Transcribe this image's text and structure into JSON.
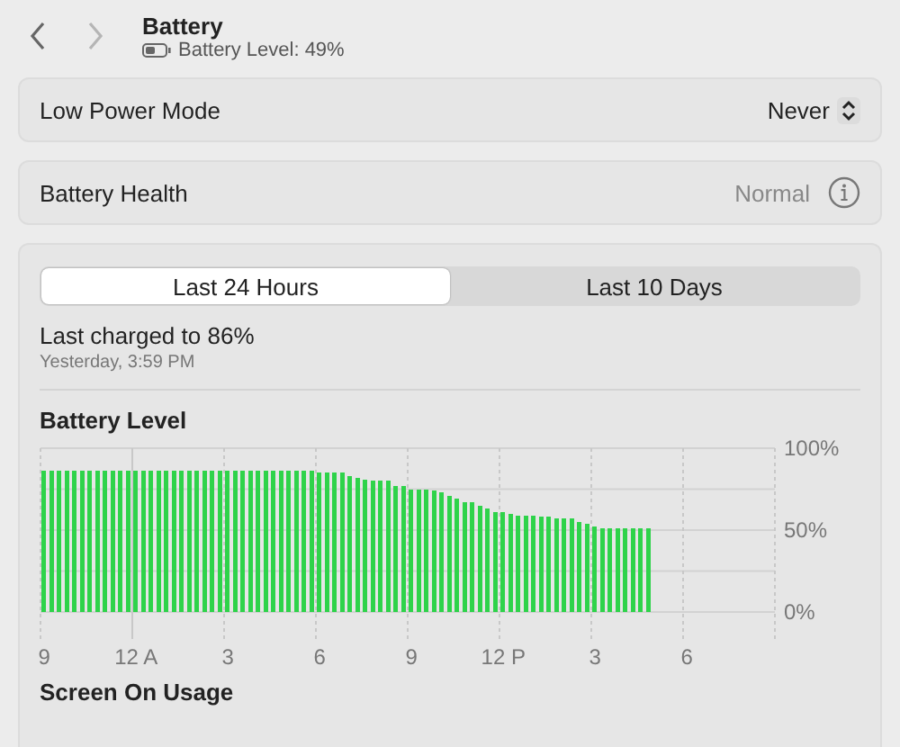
{
  "header": {
    "title": "Battery",
    "subtitle": "Battery Level: 49%"
  },
  "settings": [
    {
      "kind": "popup",
      "label": "Low Power Mode",
      "value": "Never"
    },
    {
      "kind": "info",
      "label": "Battery Health",
      "value": "Normal"
    }
  ],
  "history": {
    "tabs": [
      {
        "label": "Last 24 Hours",
        "selected": true
      },
      {
        "label": "Last 10 Days",
        "selected": false
      }
    ],
    "last_charged": "Last charged to 86%",
    "charged_time": "Yesterday, 3:59 PM",
    "battery_chart": {
      "chart_data": {
        "type": "bar",
        "title": "Battery Level",
        "categories": [
          "9",
          null,
          null,
          null,
          null,
          null,
          null,
          null,
          null,
          null,
          null,
          null,
          "12 A",
          null,
          null,
          null,
          null,
          null,
          null,
          null,
          null,
          null,
          null,
          null,
          "3",
          null,
          null,
          null,
          null,
          null,
          null,
          null,
          null,
          null,
          null,
          null,
          "6",
          null,
          null,
          null,
          null,
          null,
          null,
          null,
          null,
          null,
          null,
          null,
          "9",
          null,
          null,
          null,
          null,
          null,
          null,
          null,
          null,
          null,
          null,
          null,
          "12 P",
          null,
          null,
          null,
          null,
          null,
          null,
          null,
          null,
          null,
          null,
          null,
          "3",
          null,
          null,
          null,
          null,
          null,
          null,
          null,
          null,
          null,
          null,
          null,
          "6",
          null,
          null,
          null,
          null,
          null,
          null,
          null,
          null,
          null,
          null,
          null
        ],
        "series": [
          {
            "color": "#2ed34a",
            "values": [
              86,
              86,
              86,
              86,
              86,
              86,
              86,
              86,
              86,
              86,
              86,
              86,
              86,
              86,
              86,
              86,
              86,
              86,
              86,
              86,
              86,
              86,
              86,
              86,
              86,
              86,
              86,
              86,
              86,
              86,
              86,
              86,
              86,
              86,
              86,
              86,
              85,
              85,
              85,
              85,
              83,
              82,
              81,
              80,
              80,
              80,
              77,
              77,
              75,
              75,
              75,
              74,
              73,
              71,
              69,
              67,
              67,
              65,
              63,
              61,
              61,
              60,
              59,
              59,
              59,
              58,
              58,
              57,
              57,
              57,
              55,
              54,
              52,
              51,
              51,
              51,
              51,
              51,
              51,
              51,
              null,
              null,
              null,
              null,
              null,
              null,
              null,
              null,
              null,
              null,
              null,
              null,
              null,
              null,
              null,
              null
            ]
          }
        ],
        "ylim": [
          0,
          100
        ],
        "yticks": [
          {
            "value": 0,
            "label": "0%"
          },
          {
            "value": 50,
            "label": "50%"
          },
          {
            "value": 100,
            "label": "100%"
          }
        ]
      }
    },
    "next_section": "Screen On Usage"
  }
}
